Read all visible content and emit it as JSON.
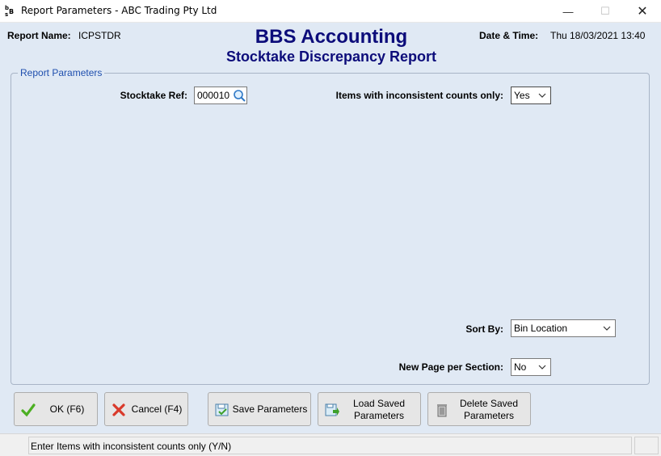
{
  "window": {
    "title": "Report Parameters - ABC Trading Pty Ltd",
    "minimize_glyph": "—",
    "maximize_glyph": "☐",
    "close_glyph": "✕"
  },
  "header": {
    "report_name_label": "Report Name:",
    "report_name_value": "ICPSTDR",
    "brand": "BBS Accounting",
    "subtitle": "Stocktake Discrepancy Report",
    "datetime_label": "Date & Time:",
    "datetime_value": "Thu 18/03/2021 13:40"
  },
  "group": {
    "legend": "Report Parameters"
  },
  "fields": {
    "stocktake_ref_label": "Stocktake Ref:",
    "stocktake_ref_value": "000010",
    "inconsistent_label": "Items with inconsistent counts only:",
    "inconsistent_value": "Yes",
    "sort_by_label": "Sort By:",
    "sort_by_value": "Bin Location",
    "new_page_label": "New Page per Section:",
    "new_page_value": "No"
  },
  "buttons": {
    "ok": "OK (F6)",
    "cancel": "Cancel (F4)",
    "save": "Save Parameters",
    "load_line1": "Load Saved",
    "load_line2": "Parameters",
    "delete_line1": "Delete Saved",
    "delete_line2": "Parameters"
  },
  "status": {
    "text": "Enter Items with inconsistent counts only (Y/N)"
  },
  "colors": {
    "background": "#e0e9f4",
    "brand": "#0c0c7a",
    "legend": "#1f4fae"
  }
}
